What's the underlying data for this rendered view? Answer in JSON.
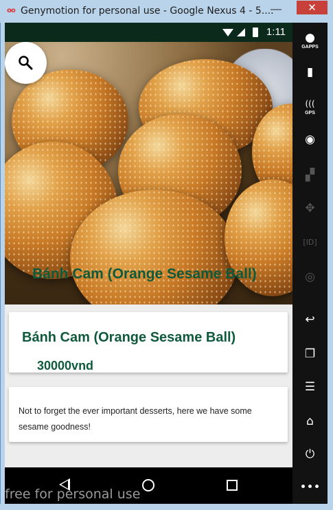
{
  "window": {
    "title": "Genymotion for personal use - Google Nexus 4 - 5....",
    "minimize": "—",
    "close": "✕"
  },
  "statusbar": {
    "time": "1:11"
  },
  "hero": {
    "caption": "Bánh Cam (Orange Sesame Ball)"
  },
  "item": {
    "title": "Bánh Cam (Orange Sesame Ball)",
    "price": "30000vnd",
    "description": "Not to forget the ever important desserts, here we have some sesame goodness!"
  },
  "watermark": "free for personal use",
  "toolbar": {
    "gapps": "GAPPS",
    "gps": "GPS",
    "buttons": [
      "gapps",
      "battery",
      "gps",
      "webcam",
      "screencast",
      "remote-control",
      "identifiers",
      "disk-io",
      "back",
      "recent-apps",
      "menu",
      "home",
      "power",
      "more"
    ]
  },
  "colors": {
    "accent": "#0e5a3a",
    "statusbar": "#0b2a1c",
    "close": "#c7403a"
  }
}
